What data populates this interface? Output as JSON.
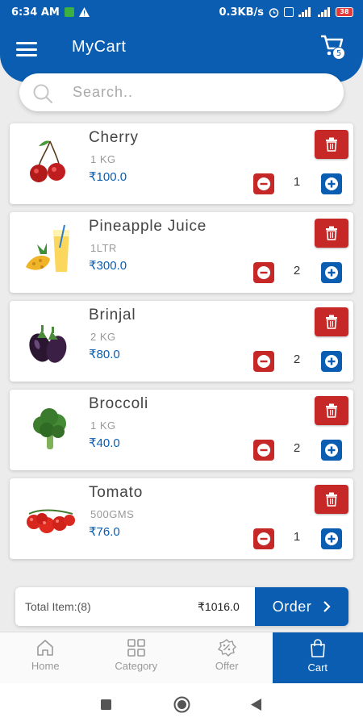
{
  "status": {
    "time": "6:34 AM",
    "network_speed": "0.3KB/s",
    "battery": "38"
  },
  "header": {
    "title": "MyCart",
    "cart_count": "5"
  },
  "search": {
    "placeholder": "Search.."
  },
  "cart": {
    "items": [
      {
        "name": "Cherry",
        "quantity": "1 KG",
        "price": "₹100.0",
        "count": "1"
      },
      {
        "name": "Pineapple Juice",
        "quantity": "1LTR",
        "price": "₹300.0",
        "count": "2"
      },
      {
        "name": "Brinjal",
        "quantity": "2 KG",
        "price": "₹80.0",
        "count": "2"
      },
      {
        "name": "Broccoli",
        "quantity": "1 KG",
        "price": "₹40.0",
        "count": "2"
      },
      {
        "name": "Tomato",
        "quantity": "500GMS",
        "price": "₹76.0",
        "count": "1"
      }
    ]
  },
  "summary": {
    "total_items": "Total Item:(8)",
    "total_amount": "₹1016.0",
    "order_label": "Order"
  },
  "bottom_nav": {
    "items": [
      {
        "label": "Home"
      },
      {
        "label": "Category"
      },
      {
        "label": "Offer"
      },
      {
        "label": "Cart"
      }
    ]
  },
  "colors": {
    "primary": "#0a5db0",
    "danger": "#c62828"
  }
}
